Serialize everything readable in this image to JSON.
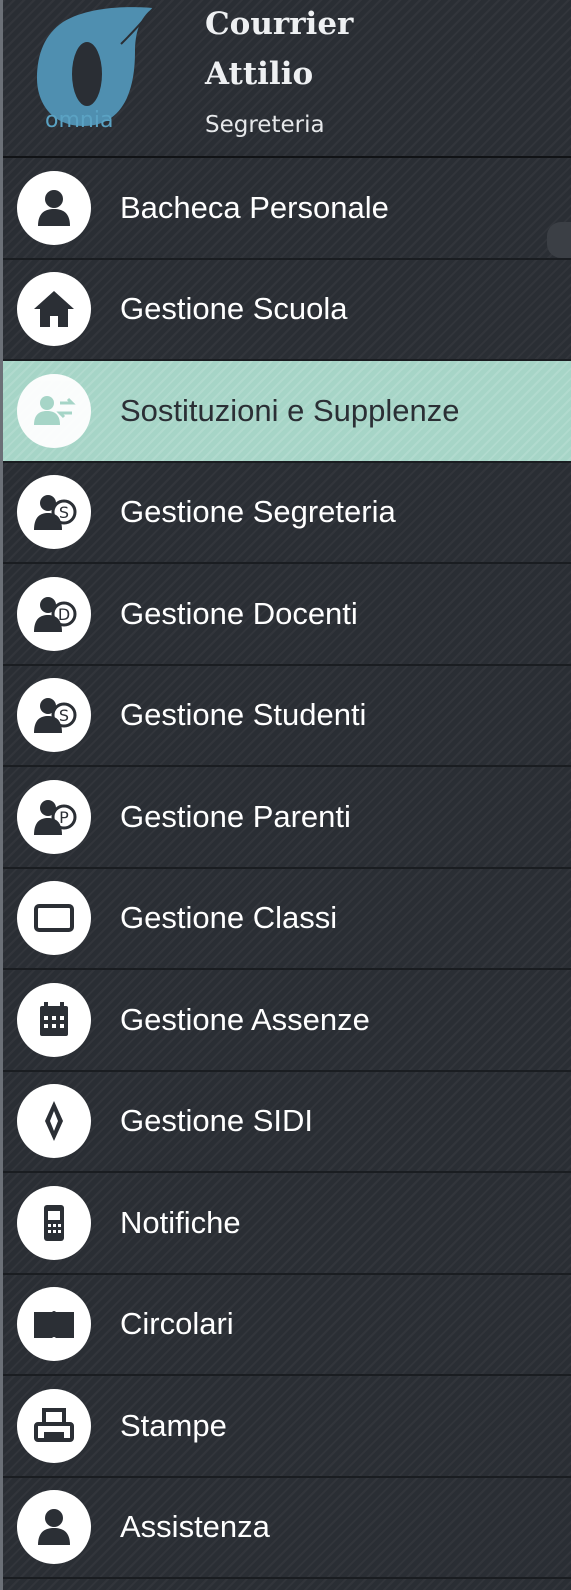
{
  "user": {
    "first_name": "Courrier",
    "last_name": "Attilio",
    "role": "Segreteria"
  },
  "logo": {
    "text": "omnia"
  },
  "menu": {
    "items": [
      {
        "label": "Bacheca Personale",
        "icon": "user-icon"
      },
      {
        "label": "Gestione Scuola",
        "icon": "home-icon"
      },
      {
        "label": "Sostituzioni e Supplenze",
        "icon": "swap-users-icon",
        "active": true
      },
      {
        "label": "Gestione Segreteria",
        "icon": "user-s-icon"
      },
      {
        "label": "Gestione Docenti",
        "icon": "user-d-icon"
      },
      {
        "label": "Gestione Studenti",
        "icon": "user-s-icon"
      },
      {
        "label": "Gestione Parenti",
        "icon": "user-p-icon"
      },
      {
        "label": "Gestione Classi",
        "icon": "classroom-icon"
      },
      {
        "label": "Gestione Assenze",
        "icon": "calendar-icon"
      },
      {
        "label": "Gestione SIDI",
        "icon": "compass-icon"
      },
      {
        "label": "Notifiche",
        "icon": "phone-icon"
      },
      {
        "label": "Circolari",
        "icon": "book-icon"
      },
      {
        "label": "Stampe",
        "icon": "printer-icon"
      },
      {
        "label": "Assistenza",
        "icon": "support-user-icon"
      }
    ]
  },
  "colors": {
    "active_bg": "#a6d5c7",
    "sidebar_bg": "#2a2e34",
    "logo_blue": "#5aa2c3"
  }
}
